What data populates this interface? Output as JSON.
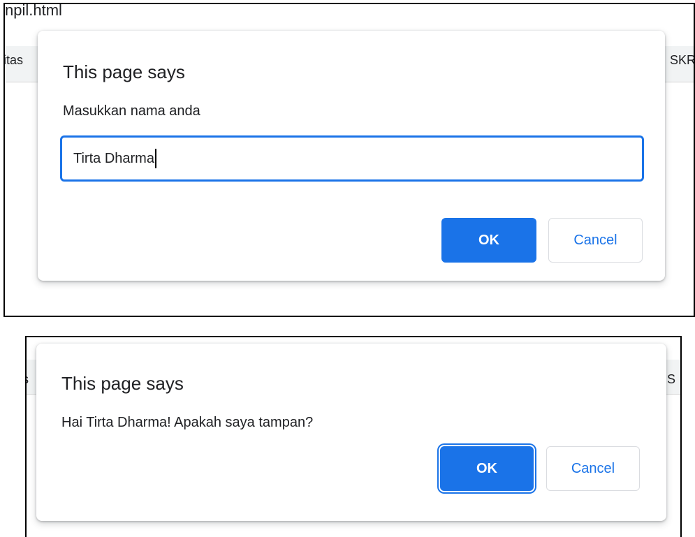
{
  "top_panel": {
    "tab_title": "npil.html",
    "bookmark_left": "itas",
    "bookmark_right": "SKR",
    "dialog": {
      "title": "This page says",
      "message": "Masukkan nama anda",
      "input_value": "Tirta Dharma",
      "ok_label": "OK",
      "cancel_label": "Cancel"
    }
  },
  "bottom_panel": {
    "bookmark_left": "s",
    "bookmark_right": "S",
    "dialog": {
      "title": "This page says",
      "message": "Hai Tirta Dharma! Apakah saya tampan?",
      "ok_label": "OK",
      "cancel_label": "Cancel"
    }
  },
  "colors": {
    "accent": "#1a73e8",
    "toolbar_bg": "#f1f3f4",
    "text": "#202124"
  }
}
